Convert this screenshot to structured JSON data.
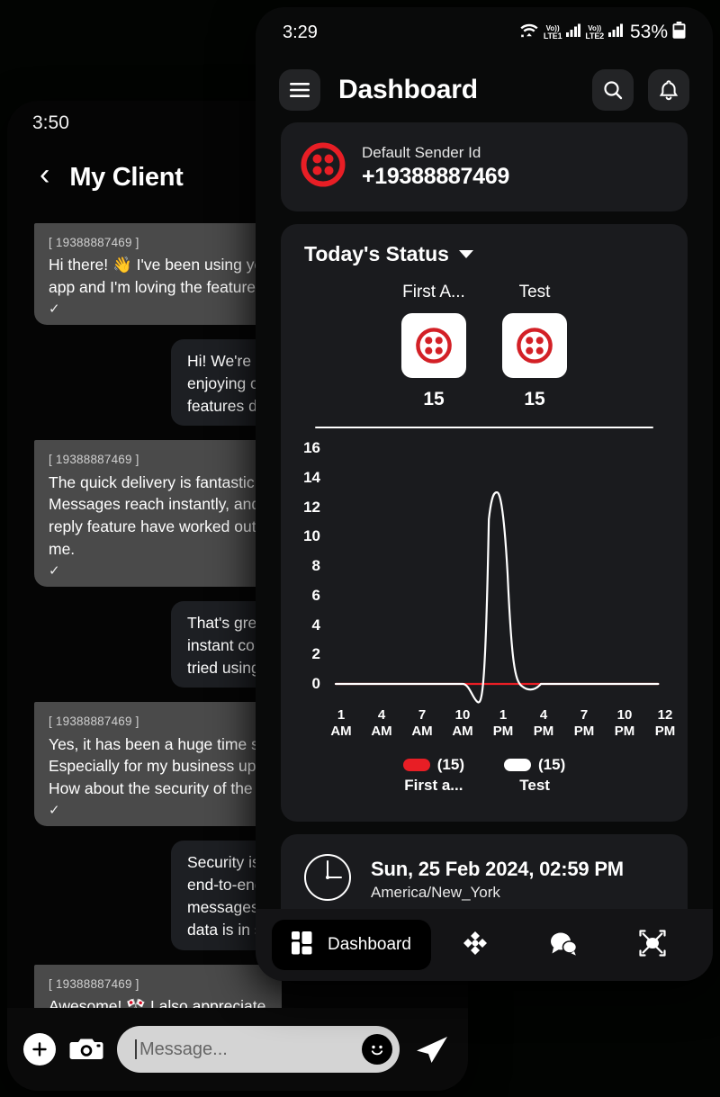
{
  "left_phone": {
    "status_time": "3:50",
    "header": {
      "back_icon": "chevron-left-icon",
      "title": "My Client"
    },
    "messages": [
      {
        "dir": "in",
        "sender": "[ 19388887469 ]",
        "lines": [
          "Hi there! 👋 I've been using your",
          "app and I'm loving the features"
        ],
        "tick": "✓"
      },
      {
        "dir": "out",
        "sender": "",
        "lines": [
          "Hi! We're thrilled",
          "enjoying our app",
          "features do you"
        ],
        "tick": ""
      },
      {
        "dir": "in",
        "sender": "[ 19388887469 ]",
        "lines": [
          "The quick delivery is fantastic.",
          "Messages reach instantly, and",
          "reply feature have worked out",
          "me."
        ],
        "tick": "✓"
      },
      {
        "dir": "out",
        "sender": "",
        "lines": [
          "That's great to h",
          "instant commun",
          "tried using our c"
        ],
        "tick": ""
      },
      {
        "dir": "in",
        "sender": "[ 19388887469 ]",
        "lines": [
          "Yes, it has been a huge time s",
          "Especially for my business up",
          "How about the security of the"
        ],
        "tick": "✓"
      },
      {
        "dir": "out",
        "sender": "",
        "lines": [
          "Security is a top",
          "end-to-end encry",
          "messages are p",
          "data is in safe ha"
        ],
        "tick": ""
      },
      {
        "dir": "in",
        "sender": "[ 19388887469 ]",
        "lines": [
          "Awesome! 🎌 I also appreciate"
        ],
        "tick": ""
      }
    ],
    "input_bar": {
      "add_icon": "plus-icon",
      "camera_icon": "camera-icon",
      "placeholder": "Message...",
      "emoji_icon": "smiley-icon",
      "send_icon": "send-icon"
    }
  },
  "right_phone": {
    "status": {
      "time": "3:29",
      "wifi_icon": "wifi-icon",
      "sim1_label_top": "Vo))",
      "sim1_label_bottom": "LTE1",
      "sim2_label_top": "Vo))",
      "sim2_label_bottom": "LTE2",
      "battery_pct": "53%",
      "battery_icon": "battery-icon"
    },
    "appbar": {
      "menu_icon": "hamburger-menu-icon",
      "title": "Dashboard",
      "search_icon": "search-icon",
      "bell_icon": "bell-icon"
    },
    "sender_card": {
      "logo_icon": "twilio-logo-icon",
      "label": "Default Sender Id",
      "number": "+19388887469"
    },
    "status_card": {
      "title": "Today's Status",
      "dropdown_icon": "chevron-down-icon",
      "tiles": [
        {
          "name": "First A...",
          "icon": "twilio-logo-icon",
          "count": "15"
        },
        {
          "name": "Test",
          "icon": "twilio-logo-icon",
          "count": "15"
        }
      ]
    },
    "time_card": {
      "clock_icon": "clock-icon",
      "datetime": "Sun, 25 Feb 2024, 02:59 PM",
      "timezone": "America/New_York"
    },
    "bottom_nav": [
      {
        "name": "dashboard",
        "icon": "dashboard-grid-icon",
        "label": "Dashboard",
        "active": true
      },
      {
        "name": "campaign",
        "icon": "diamond-nodes-icon",
        "label": "",
        "active": false
      },
      {
        "name": "chat",
        "icon": "chat-bubbles-icon",
        "label": "",
        "active": false
      },
      {
        "name": "broadcast",
        "icon": "broadcast-network-icon",
        "label": "",
        "active": false
      }
    ]
  },
  "chart_data": {
    "type": "line",
    "title": "Today's Status",
    "xlabel": "",
    "ylabel": "",
    "ylim": [
      0,
      16
    ],
    "yticks": [
      16,
      14,
      12,
      10,
      8,
      6,
      4,
      2,
      0
    ],
    "xticks": [
      "1 AM",
      "4 AM",
      "7 AM",
      "10 AM",
      "1 PM",
      "4 PM",
      "7 PM",
      "10 PM",
      "12 PM"
    ],
    "xtick_hours": [
      "1",
      "4",
      "7",
      "10",
      "1",
      "4",
      "7",
      "10",
      "12"
    ],
    "xtick_meridiem": [
      "AM",
      "AM",
      "AM",
      "AM",
      "PM",
      "PM",
      "PM",
      "PM",
      "PM"
    ],
    "grid": false,
    "legend_position": "bottom",
    "series": [
      {
        "name": "First a...",
        "color": "#e81e25",
        "total": "(15)",
        "categories": [
          "1 AM",
          "4 AM",
          "7 AM",
          "10 AM",
          "1 PM",
          "4 PM",
          "7 PM",
          "10 PM",
          "12 PM"
        ],
        "values": [
          0,
          0,
          0,
          0,
          0,
          0,
          0,
          0,
          0
        ]
      },
      {
        "name": "Test",
        "color": "#ffffff",
        "total": "(15)",
        "categories": [
          "1 AM",
          "4 AM",
          "7 AM",
          "10 AM",
          "1 PM",
          "4 PM",
          "7 PM",
          "10 PM",
          "12 PM"
        ],
        "values": [
          0,
          0,
          0,
          0,
          13,
          0,
          0,
          0,
          0
        ]
      }
    ],
    "annotations": [
      "White series spikes to 13 at approximately 1 PM with a brief dip below 0 just before the peak; all other hours read 0"
    ]
  }
}
